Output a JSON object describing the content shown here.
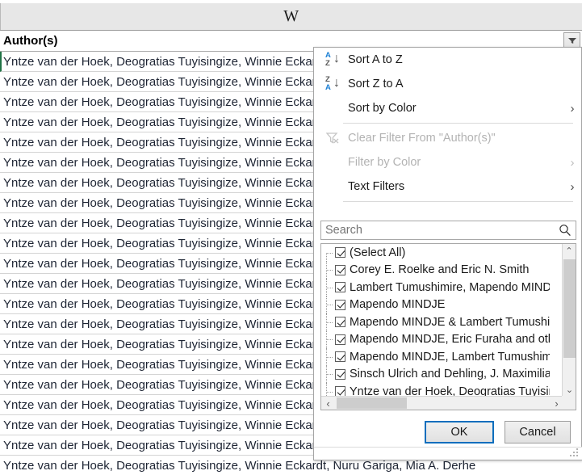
{
  "spreadsheet": {
    "column_letter": "W",
    "header_label": "Author(s)",
    "rows": [
      "Yntze van der Hoek, Deogratias Tuyisingize, Winnie Eckardt, Nuru Gariga, Mia A. Derhe",
      "Yntze van der Hoek, Deogratias Tuyisingize, Winnie Eckardt, Nuru Gariga, Mia A. Derhe",
      "Yntze van der Hoek, Deogratias Tuyisingize, Winnie Eckardt, Nuru Gariga, Mia A. Derhe",
      "Yntze van der Hoek, Deogratias Tuyisingize, Winnie Eckardt, Nuru Gariga, Mia A. Derhe",
      "Yntze van der Hoek, Deogratias Tuyisingize, Winnie Eckardt, Nuru Gariga, Mia A. Derhe",
      "Yntze van der Hoek, Deogratias Tuyisingize, Winnie Eckardt, Nuru Gariga, Mia A. Derhe",
      "Yntze van der Hoek, Deogratias Tuyisingize, Winnie Eckardt, Nuru Gariga, Mia A. Derhe",
      "Yntze van der Hoek, Deogratias Tuyisingize, Winnie Eckardt, Nuru Gariga, Mia A. Derhe",
      "Yntze van der Hoek, Deogratias Tuyisingize, Winnie Eckardt, Nuru Gariga, Mia A. Derhe",
      "Yntze van der Hoek, Deogratias Tuyisingize, Winnie Eckardt, Nuru Gariga, Mia A. Derhe",
      "Yntze van der Hoek, Deogratias Tuyisingize, Winnie Eckardt, Nuru Gariga, Mia A. Derhe",
      "Yntze van der Hoek, Deogratias Tuyisingize, Winnie Eckardt, Nuru Gariga, Mia A. Derhe",
      "Yntze van der Hoek, Deogratias Tuyisingize, Winnie Eckardt, Nuru Gariga, Mia A. Derhe",
      "Yntze van der Hoek, Deogratias Tuyisingize, Winnie Eckardt, Nuru Gariga, Mia A. Derhe",
      "Yntze van der Hoek, Deogratias Tuyisingize, Winnie Eckardt, Nuru Gariga, Mia A. Derhe",
      "Yntze van der Hoek, Deogratias Tuyisingize, Winnie Eckardt, Nuru Gariga, Mia A. Derhe",
      "Yntze van der Hoek, Deogratias Tuyisingize, Winnie Eckardt, Nuru Gariga, Mia A. Derhe",
      "Yntze van der Hoek, Deogratias Tuyisingize, Winnie Eckardt, Nuru Gariga, Mia A. Derhe",
      "Yntze van der Hoek, Deogratias Tuyisingize, Winnie Eckardt, Nuru Gariga, Mia A. Derhe",
      "Yntze van der Hoek, Deogratias Tuyisingize, Winnie Eckardt, Nuru Gariga, Mia A. Derhe",
      "Yntze van der Hoek, Deogratias Tuyisingize, Winnie Eckardt, Nuru Gariga, Mia A. Derhe"
    ]
  },
  "dropdown": {
    "sort_a_to_z": "Sort A to Z",
    "sort_z_to_a": "Sort Z to A",
    "sort_by_color": "Sort by Color",
    "clear_filter": "Clear Filter From \"Author(s)\"",
    "filter_by_color": "Filter by Color",
    "text_filters": "Text Filters",
    "sort_az_glyph_top": "A",
    "sort_az_glyph_bottom": "Z",
    "sort_za_glyph_top": "Z",
    "sort_za_glyph_bottom": "A",
    "submenu_arrow": "›",
    "search": {
      "placeholder": "Search",
      "value": ""
    },
    "checklist": [
      {
        "label": "(Select All)",
        "checked": true
      },
      {
        "label": "Corey E. Roelke and Eric N. Smith",
        "checked": true
      },
      {
        "label": "Lambert Tumushimire, Mapendo MINDJE",
        "checked": true
      },
      {
        "label": "Mapendo MINDJE",
        "checked": true
      },
      {
        "label": "Mapendo MINDJE & Lambert Tumushimire",
        "checked": true
      },
      {
        "label": "Mapendo MINDJE, Eric Furaha and others",
        "checked": true
      },
      {
        "label": "Mapendo MINDJE, Lambert Tumushimire",
        "checked": true
      },
      {
        "label": "Sinsch Ulrich and Dehling, J. Maximilian",
        "checked": true
      },
      {
        "label": "Yntze van der Hoek, Deogratias Tuyisingize",
        "checked": true
      }
    ],
    "buttons": {
      "ok": "OK",
      "cancel": "Cancel"
    },
    "scroll_arrows": {
      "up": "⌃",
      "down": "⌄",
      "left": "‹",
      "right": "›"
    }
  },
  "colors": {
    "accent_blue": "#0a6ebd",
    "sort_glyph_blue": "#1b7fd4",
    "selection_green": "#217346",
    "disabled_gray": "#b3b3b3"
  }
}
